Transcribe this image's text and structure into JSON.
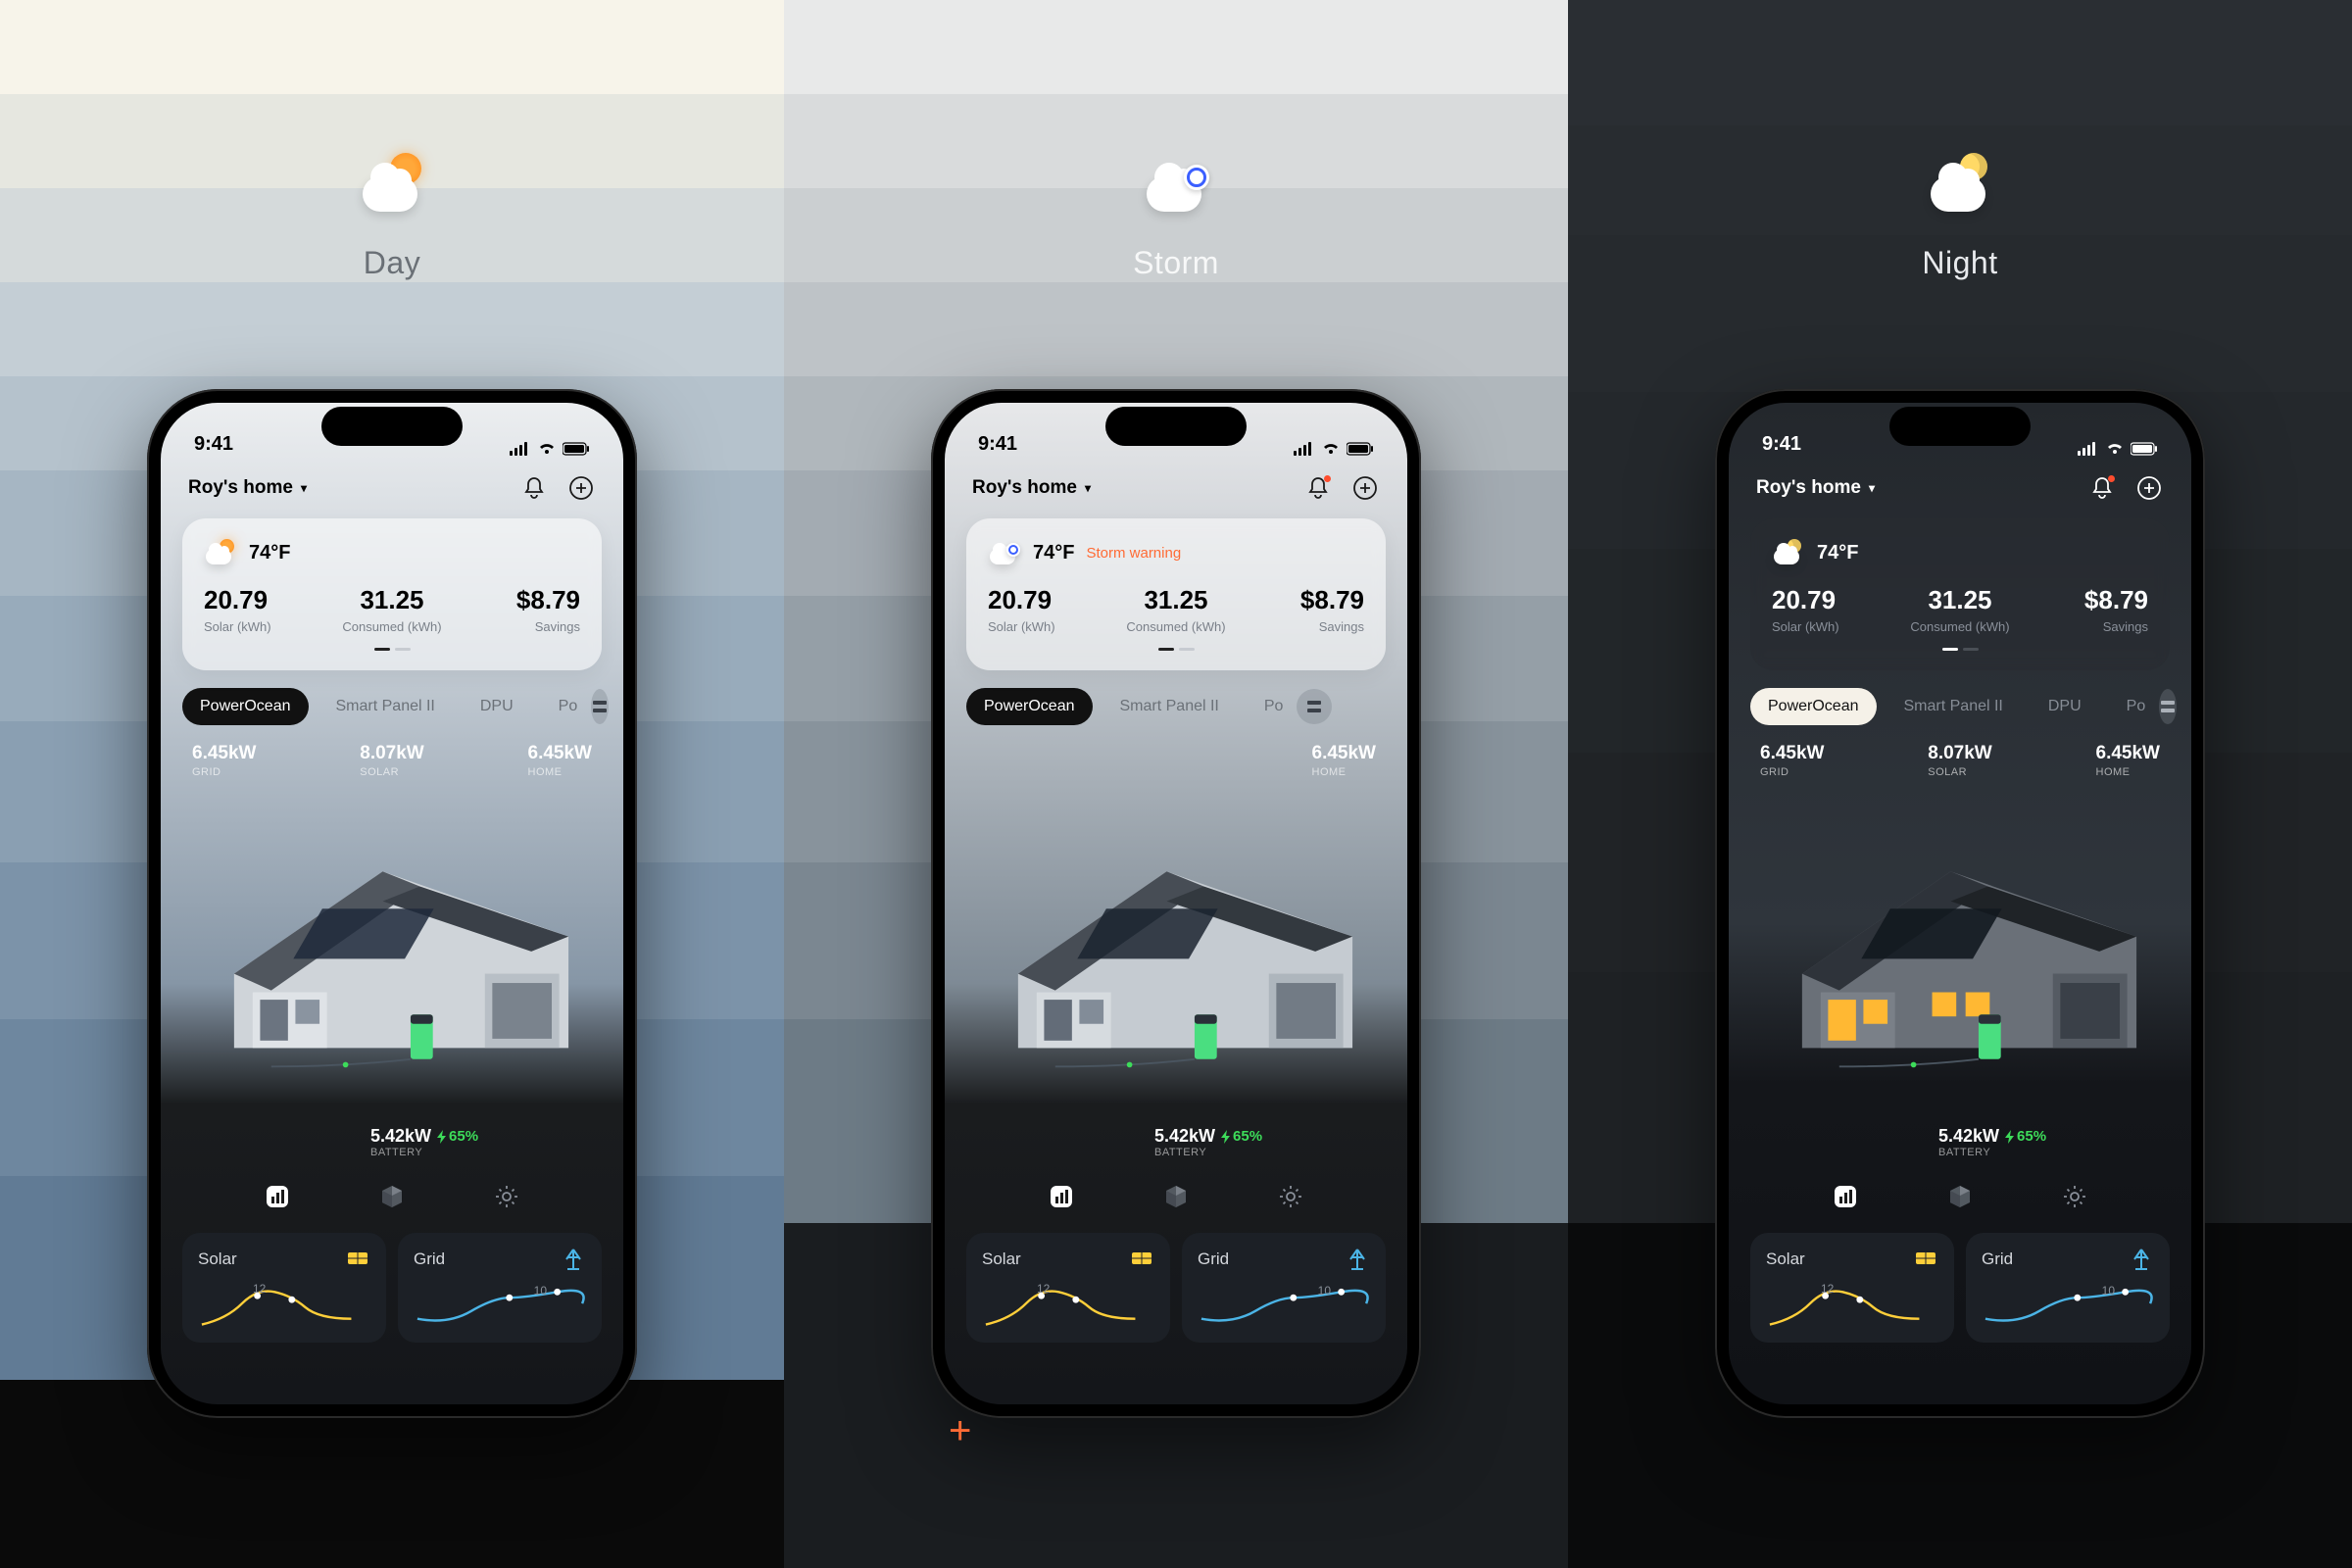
{
  "panels": {
    "day": {
      "label": "Day"
    },
    "storm": {
      "label": "Storm"
    },
    "night": {
      "label": "Night"
    }
  },
  "status": {
    "time": "9:41"
  },
  "header": {
    "home_name": "Roy's home"
  },
  "weather": {
    "temp": "74°F",
    "storm_warning": "Storm warning"
  },
  "summary": {
    "solar": {
      "value": "20.79",
      "label": "Solar (kWh)"
    },
    "consumed": {
      "value": "31.25",
      "label": "Consumed (kWh)"
    },
    "savings": {
      "value": "$8.79",
      "label": "Savings"
    }
  },
  "tabs": {
    "items": [
      "PowerOcean",
      "Smart Panel II",
      "DPU",
      "Po"
    ]
  },
  "energy": {
    "grid": {
      "value": "6.45kW",
      "label": "GRID"
    },
    "solar": {
      "value": "8.07kW",
      "label": "SOLAR"
    },
    "home": {
      "value": "6.45kW",
      "label": "HOME"
    }
  },
  "battery": {
    "value": "5.42kW",
    "percent": "65%",
    "label": "BATTERY"
  },
  "mini": {
    "solar": {
      "title": "Solar",
      "peak": "12"
    },
    "grid": {
      "title": "Grid",
      "peak": "10"
    }
  },
  "colors": {
    "accent_orange": "#ff6b35",
    "accent_green": "#3ddc5a",
    "solar_line": "#ffcf3a",
    "grid_line": "#4bb4e6"
  }
}
